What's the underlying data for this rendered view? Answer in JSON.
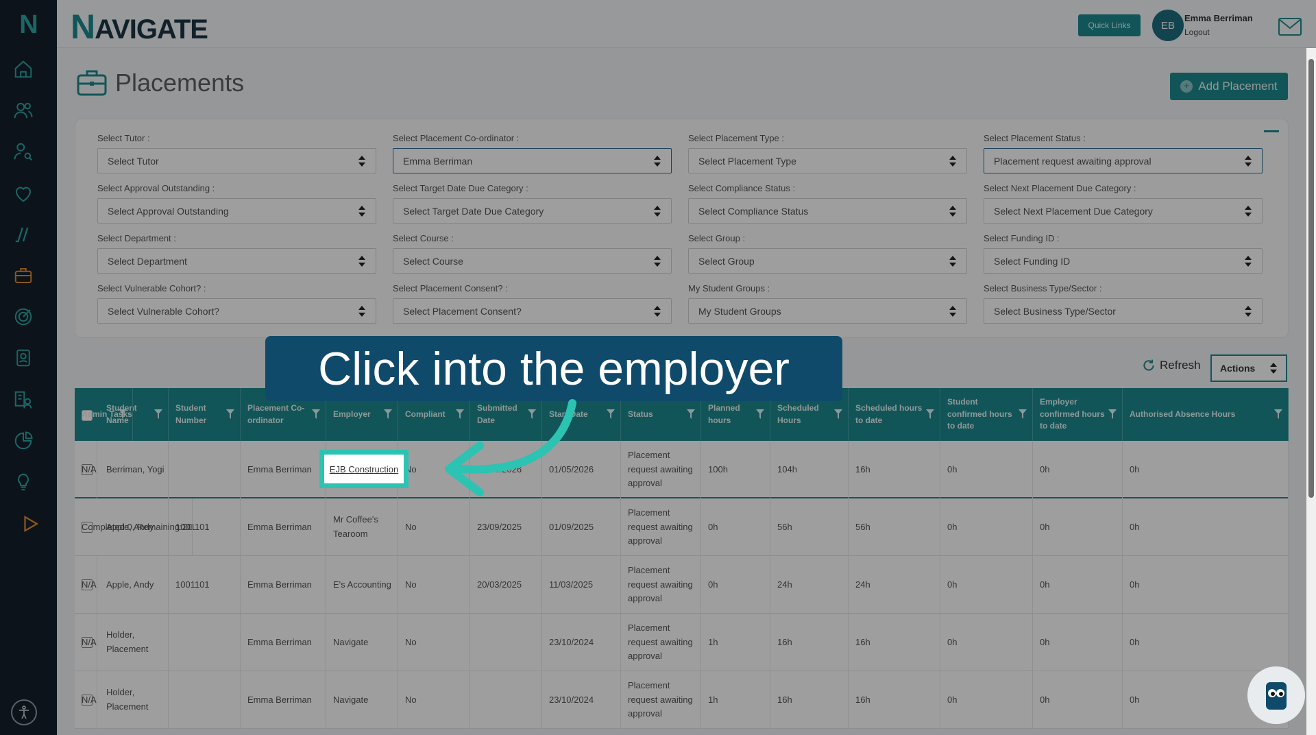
{
  "brand": {
    "logo_letter": "N",
    "name_n": "N",
    "name_rest": "AVIGATE"
  },
  "header": {
    "quick_links": "Quick Links",
    "avatar_initials": "EB",
    "user_name": "Emma Berriman",
    "logout": "Logout"
  },
  "page": {
    "title": "Placements",
    "add_button": "Add Placement"
  },
  "filters": [
    {
      "label": "Select Tutor :",
      "value": "Select Tutor"
    },
    {
      "label": "Select Placement Co-ordinator :",
      "value": "Emma Berriman"
    },
    {
      "label": "Select Placement Type :",
      "value": "Select Placement Type"
    },
    {
      "label": "Select Placement Status :",
      "value": "Placement request awaiting approval"
    },
    {
      "label": "Select Approval Outstanding :",
      "value": "Select Approval Outstanding"
    },
    {
      "label": "Select Target Date Due Category :",
      "value": "Select Target Date Due Category"
    },
    {
      "label": "Select Compliance Status :",
      "value": "Select Compliance Status"
    },
    {
      "label": "Select Next Placement Due Category :",
      "value": "Select Next Placement Due Category"
    },
    {
      "label": "Select Department :",
      "value": "Select Department"
    },
    {
      "label": "Select Course :",
      "value": "Select Course"
    },
    {
      "label": "Select Group :",
      "value": "Select Group"
    },
    {
      "label": "Select Funding ID :",
      "value": "Select Funding ID"
    },
    {
      "label": "Select Vulnerable Cohort? :",
      "value": "Select Vulnerable Cohort?"
    },
    {
      "label": "Select Placement Consent? :",
      "value": "Select Placement Consent?"
    },
    {
      "label": "My Student Groups :",
      "value": "My Student Groups"
    },
    {
      "label": "Select Business Type/Sector :",
      "value": "Select Business Type/Sector"
    }
  ],
  "toolbar": {
    "refresh": "Refresh",
    "actions": "Actions"
  },
  "table": {
    "headers": [
      "Student Name",
      "Student Number",
      "Placement Co-ordinator",
      "Employer",
      "Compliant",
      "Submitted Date",
      "Start Date",
      "Status",
      "Planned hours",
      "Scheduled Hours",
      "Scheduled hours to date",
      "Student confirmed hours to date",
      "Employer confirmed hours to date",
      "Authorised Absence Hours",
      "Admin Tasks"
    ],
    "rows": [
      [
        "Berriman, Yogi",
        "",
        "Emma Berriman",
        "EJB Construction",
        "No",
        "01/05/2026",
        "01/05/2026",
        "Placement request awaiting approval",
        "100h",
        "104h",
        "16h",
        "0h",
        "0h",
        "0h",
        "N/A"
      ],
      [
        "Apple, Andy",
        "1001101",
        "Emma Berriman",
        "Mr Coffee's Tearoom",
        "No",
        "23/09/2025",
        "01/09/2025",
        "Placement request awaiting approval",
        "0h",
        "56h",
        "56h",
        "0h",
        "0h",
        "0h",
        "Completed:0, Remaining:20"
      ],
      [
        "Apple, Andy",
        "1001101",
        "Emma Berriman",
        "E's Accounting",
        "No",
        "20/03/2025",
        "11/03/2025",
        "Placement request awaiting approval",
        "0h",
        "24h",
        "24h",
        "0h",
        "0h",
        "0h",
        "N/A"
      ],
      [
        "Holder, Placement",
        "",
        "Emma Berriman",
        "Navigate",
        "No",
        "",
        "23/10/2024",
        "Placement request awaiting approval",
        "1h",
        "16h",
        "16h",
        "0h",
        "0h",
        "0h",
        "N/A"
      ],
      [
        "Holder, Placement",
        "",
        "Emma Berriman",
        "Navigate",
        "No",
        "",
        "23/10/2024",
        "Placement request awaiting approval",
        "1h",
        "16h",
        "16h",
        "0h",
        "0h",
        "0h",
        "N/A"
      ]
    ]
  },
  "callout": {
    "text": "Click into the employer"
  },
  "colors": {
    "accent": "#1e8a8f",
    "sidebar": "#15202b",
    "callout": "#0f4a6b",
    "highlight": "#2cc3b2"
  }
}
